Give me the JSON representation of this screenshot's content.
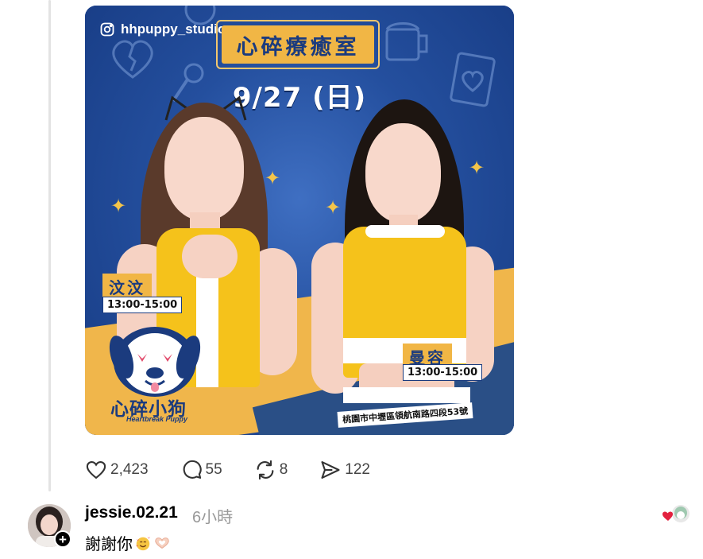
{
  "post": {
    "image": {
      "handle": "hhpuppy_studio",
      "title": "心碎療癒室",
      "date": "9/27 (日)",
      "left_member": {
        "name": "汶汶",
        "time": "13:00-15:00"
      },
      "right_member": {
        "name": "曼容",
        "time": "13:00-15:00"
      },
      "logo_title": "心碎小狗",
      "logo_subtitle": "Heartbreak Puppy",
      "address": "桃園市中壢區領航南路四段53號",
      "colors": {
        "navy": "#1d4797",
        "yellow": "#f1b645",
        "uniform": "#f5c21b"
      }
    },
    "actions": {
      "likes": "2,423",
      "comments": "55",
      "reposts": "8",
      "shares": "122"
    }
  },
  "reply": {
    "username": "jessie.02.21",
    "time": "6小時",
    "text": "謝謝你",
    "emojis": [
      "smiling-face-with-hearts-emoji",
      "heart-hands-emoji"
    ]
  }
}
